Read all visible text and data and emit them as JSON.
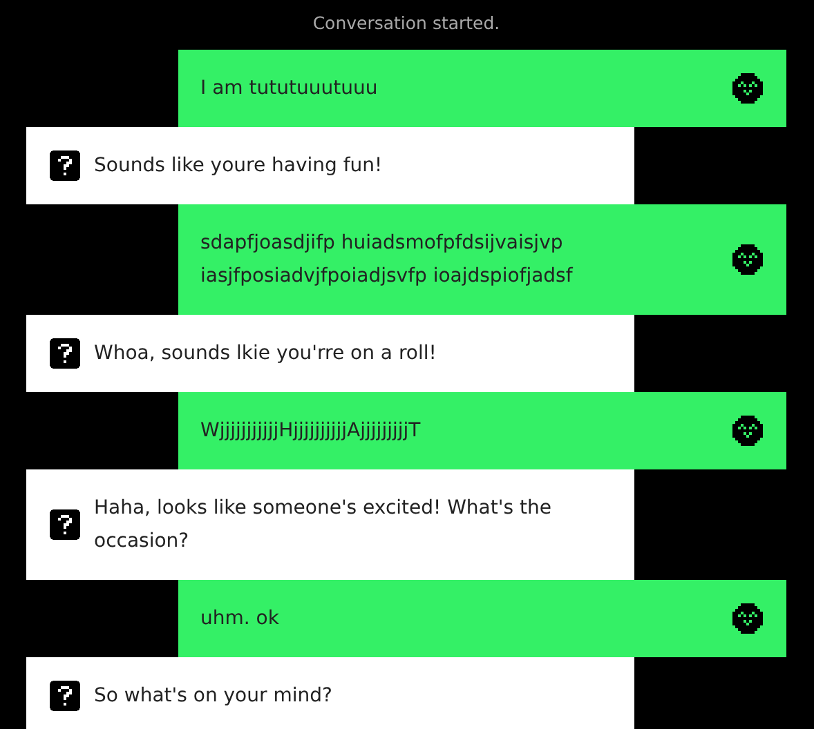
{
  "status": "Conversation started.",
  "messages": [
    {
      "kind": "user",
      "text": "I am tututuuutuuu"
    },
    {
      "kind": "bot",
      "text": "Sounds like youre having fun!"
    },
    {
      "kind": "user",
      "text": "sdapfjoasdjifp huiadsmofpfdsijvaisjvp iasjfposiadvjfpoiadjsvfp ioajdspiofjadsf"
    },
    {
      "kind": "bot",
      "text": "Whoa, sounds lkie you'rre on a roll!"
    },
    {
      "kind": "user",
      "text": "WjjjjjjjjjjjHjjjjjjjjjjAjjjjjjjjjT"
    },
    {
      "kind": "bot",
      "text": "Haha, looks like someone's excited! What's the occasion?"
    },
    {
      "kind": "user",
      "text": "uhm. ok"
    },
    {
      "kind": "bot",
      "text": "So what's on your mind?"
    }
  ]
}
